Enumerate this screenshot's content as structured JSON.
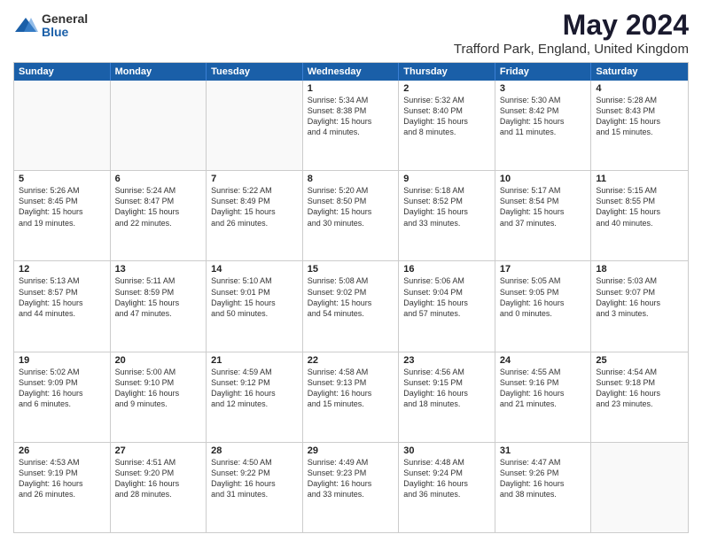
{
  "logo": {
    "general": "General",
    "blue": "Blue"
  },
  "title": "May 2024",
  "subtitle": "Trafford Park, England, United Kingdom",
  "header_days": [
    "Sunday",
    "Monday",
    "Tuesday",
    "Wednesday",
    "Thursday",
    "Friday",
    "Saturday"
  ],
  "rows": [
    [
      {
        "day": "",
        "lines": []
      },
      {
        "day": "",
        "lines": []
      },
      {
        "day": "",
        "lines": []
      },
      {
        "day": "1",
        "lines": [
          "Sunrise: 5:34 AM",
          "Sunset: 8:38 PM",
          "Daylight: 15 hours",
          "and 4 minutes."
        ]
      },
      {
        "day": "2",
        "lines": [
          "Sunrise: 5:32 AM",
          "Sunset: 8:40 PM",
          "Daylight: 15 hours",
          "and 8 minutes."
        ]
      },
      {
        "day": "3",
        "lines": [
          "Sunrise: 5:30 AM",
          "Sunset: 8:42 PM",
          "Daylight: 15 hours",
          "and 11 minutes."
        ]
      },
      {
        "day": "4",
        "lines": [
          "Sunrise: 5:28 AM",
          "Sunset: 8:43 PM",
          "Daylight: 15 hours",
          "and 15 minutes."
        ]
      }
    ],
    [
      {
        "day": "5",
        "lines": [
          "Sunrise: 5:26 AM",
          "Sunset: 8:45 PM",
          "Daylight: 15 hours",
          "and 19 minutes."
        ]
      },
      {
        "day": "6",
        "lines": [
          "Sunrise: 5:24 AM",
          "Sunset: 8:47 PM",
          "Daylight: 15 hours",
          "and 22 minutes."
        ]
      },
      {
        "day": "7",
        "lines": [
          "Sunrise: 5:22 AM",
          "Sunset: 8:49 PM",
          "Daylight: 15 hours",
          "and 26 minutes."
        ]
      },
      {
        "day": "8",
        "lines": [
          "Sunrise: 5:20 AM",
          "Sunset: 8:50 PM",
          "Daylight: 15 hours",
          "and 30 minutes."
        ]
      },
      {
        "day": "9",
        "lines": [
          "Sunrise: 5:18 AM",
          "Sunset: 8:52 PM",
          "Daylight: 15 hours",
          "and 33 minutes."
        ]
      },
      {
        "day": "10",
        "lines": [
          "Sunrise: 5:17 AM",
          "Sunset: 8:54 PM",
          "Daylight: 15 hours",
          "and 37 minutes."
        ]
      },
      {
        "day": "11",
        "lines": [
          "Sunrise: 5:15 AM",
          "Sunset: 8:55 PM",
          "Daylight: 15 hours",
          "and 40 minutes."
        ]
      }
    ],
    [
      {
        "day": "12",
        "lines": [
          "Sunrise: 5:13 AM",
          "Sunset: 8:57 PM",
          "Daylight: 15 hours",
          "and 44 minutes."
        ]
      },
      {
        "day": "13",
        "lines": [
          "Sunrise: 5:11 AM",
          "Sunset: 8:59 PM",
          "Daylight: 15 hours",
          "and 47 minutes."
        ]
      },
      {
        "day": "14",
        "lines": [
          "Sunrise: 5:10 AM",
          "Sunset: 9:01 PM",
          "Daylight: 15 hours",
          "and 50 minutes."
        ]
      },
      {
        "day": "15",
        "lines": [
          "Sunrise: 5:08 AM",
          "Sunset: 9:02 PM",
          "Daylight: 15 hours",
          "and 54 minutes."
        ]
      },
      {
        "day": "16",
        "lines": [
          "Sunrise: 5:06 AM",
          "Sunset: 9:04 PM",
          "Daylight: 15 hours",
          "and 57 minutes."
        ]
      },
      {
        "day": "17",
        "lines": [
          "Sunrise: 5:05 AM",
          "Sunset: 9:05 PM",
          "Daylight: 16 hours",
          "and 0 minutes."
        ]
      },
      {
        "day": "18",
        "lines": [
          "Sunrise: 5:03 AM",
          "Sunset: 9:07 PM",
          "Daylight: 16 hours",
          "and 3 minutes."
        ]
      }
    ],
    [
      {
        "day": "19",
        "lines": [
          "Sunrise: 5:02 AM",
          "Sunset: 9:09 PM",
          "Daylight: 16 hours",
          "and 6 minutes."
        ]
      },
      {
        "day": "20",
        "lines": [
          "Sunrise: 5:00 AM",
          "Sunset: 9:10 PM",
          "Daylight: 16 hours",
          "and 9 minutes."
        ]
      },
      {
        "day": "21",
        "lines": [
          "Sunrise: 4:59 AM",
          "Sunset: 9:12 PM",
          "Daylight: 16 hours",
          "and 12 minutes."
        ]
      },
      {
        "day": "22",
        "lines": [
          "Sunrise: 4:58 AM",
          "Sunset: 9:13 PM",
          "Daylight: 16 hours",
          "and 15 minutes."
        ]
      },
      {
        "day": "23",
        "lines": [
          "Sunrise: 4:56 AM",
          "Sunset: 9:15 PM",
          "Daylight: 16 hours",
          "and 18 minutes."
        ]
      },
      {
        "day": "24",
        "lines": [
          "Sunrise: 4:55 AM",
          "Sunset: 9:16 PM",
          "Daylight: 16 hours",
          "and 21 minutes."
        ]
      },
      {
        "day": "25",
        "lines": [
          "Sunrise: 4:54 AM",
          "Sunset: 9:18 PM",
          "Daylight: 16 hours",
          "and 23 minutes."
        ]
      }
    ],
    [
      {
        "day": "26",
        "lines": [
          "Sunrise: 4:53 AM",
          "Sunset: 9:19 PM",
          "Daylight: 16 hours",
          "and 26 minutes."
        ]
      },
      {
        "day": "27",
        "lines": [
          "Sunrise: 4:51 AM",
          "Sunset: 9:20 PM",
          "Daylight: 16 hours",
          "and 28 minutes."
        ]
      },
      {
        "day": "28",
        "lines": [
          "Sunrise: 4:50 AM",
          "Sunset: 9:22 PM",
          "Daylight: 16 hours",
          "and 31 minutes."
        ]
      },
      {
        "day": "29",
        "lines": [
          "Sunrise: 4:49 AM",
          "Sunset: 9:23 PM",
          "Daylight: 16 hours",
          "and 33 minutes."
        ]
      },
      {
        "day": "30",
        "lines": [
          "Sunrise: 4:48 AM",
          "Sunset: 9:24 PM",
          "Daylight: 16 hours",
          "and 36 minutes."
        ]
      },
      {
        "day": "31",
        "lines": [
          "Sunrise: 4:47 AM",
          "Sunset: 9:26 PM",
          "Daylight: 16 hours",
          "and 38 minutes."
        ]
      },
      {
        "day": "",
        "lines": []
      }
    ]
  ]
}
